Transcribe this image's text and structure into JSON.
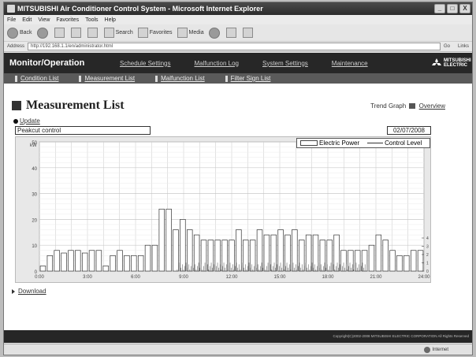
{
  "window": {
    "title": "MITSUBISHI Air Conditioner Control System - Microsoft Internet Explorer",
    "controls": [
      "_",
      "□",
      "X"
    ]
  },
  "menubar": [
    "File",
    "Edit",
    "View",
    "Favorites",
    "Tools",
    "Help"
  ],
  "toolbar": {
    "back": "Back",
    "search": "Search",
    "favorites": "Favorites",
    "media": "Media"
  },
  "address": {
    "label": "Address",
    "url": "http://192.168.1.1/en/administrator.html",
    "go": "Go",
    "links": "Links"
  },
  "nav": {
    "brand": "Monitor/Operation",
    "links": [
      "Schedule Settings",
      "Malfunction Log",
      "System Settings",
      "Maintenance"
    ],
    "logo_text": "MITSUBISHI ELECTRIC"
  },
  "subnav": [
    "Condition List",
    "Measurement List",
    "Malfunction List",
    "Filter Sign List"
  ],
  "page": {
    "title": "Measurement List",
    "trend_label": "Trend Graph",
    "overview": "Overview",
    "update": "Update",
    "condition": "Peakcut control",
    "date": "02/07/2008",
    "download": "Download"
  },
  "footer": "Copyright(C)2002-2008 MITSUBISHI ELECTRIC CORPORATION All Rights Reserved",
  "status": {
    "left": "",
    "zone": "Internet"
  },
  "chart_data": {
    "type": "bar",
    "ylabel": "kW",
    "ylim": [
      0,
      50
    ],
    "yticks": [
      0,
      10,
      20,
      30,
      40,
      50
    ],
    "y2ticks": [
      0,
      1,
      2,
      3,
      4
    ],
    "x_tick_labels": [
      "0:00",
      "3:00",
      "6:00",
      "9:00",
      "12:00",
      "15:00",
      "18:00",
      "21:00",
      "24:00"
    ],
    "legend": [
      "Electric Power",
      "Control Level"
    ],
    "values": [
      2,
      6,
      8,
      7,
      8,
      8,
      7,
      8,
      8,
      2,
      6,
      8,
      6,
      6,
      6,
      10,
      10,
      24,
      24,
      16,
      20,
      16,
      14,
      12,
      12,
      12,
      12,
      12,
      16,
      12,
      12,
      16,
      14,
      14,
      16,
      14,
      16,
      12,
      14,
      14,
      12,
      12,
      14,
      8,
      8,
      8,
      8,
      10,
      14,
      12,
      8,
      6,
      6,
      8,
      8
    ]
  }
}
